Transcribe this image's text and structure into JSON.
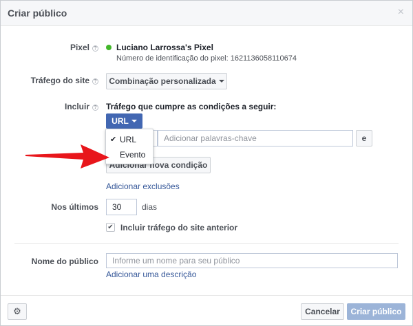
{
  "dialog": {
    "title": "Criar público",
    "close_glyph": "×"
  },
  "pixel": {
    "label": "Pixel",
    "name": "Luciano Larrossa's Pixel",
    "id_text": "Número de identificação do pixel: 1621136058110674",
    "status_color": "#42b72a"
  },
  "traffic": {
    "label": "Tráfego do site",
    "selected": "Combinação personalizada"
  },
  "include": {
    "label": "Incluir",
    "heading": "Tráfego que cumpre as condições a seguir:",
    "rule_type": "URL",
    "keywords_placeholder": "Adicionar palavras-chave",
    "and_label": "e",
    "dropdown_options": [
      {
        "label": "URL",
        "checked": true
      },
      {
        "label": "Evento",
        "checked": false
      }
    ],
    "add_condition": "Adicionar nova condição",
    "add_exclusions": "Adicionar exclusões"
  },
  "last_days": {
    "label": "Nos últimos",
    "value": "30",
    "unit": "dias"
  },
  "previous_traffic": {
    "label": "Incluir tráfego do site anterior",
    "checked": true
  },
  "audience_name": {
    "label": "Nome do público",
    "placeholder": "Informe um nome para seu público",
    "add_description": "Adicionar uma descrição"
  },
  "footer": {
    "cancel": "Cancelar",
    "create": "Criar público"
  },
  "colors": {
    "accent": "#4267b2",
    "link": "#365899",
    "arrow": "#e8161b",
    "create_disabled": "#9cb4d8"
  }
}
